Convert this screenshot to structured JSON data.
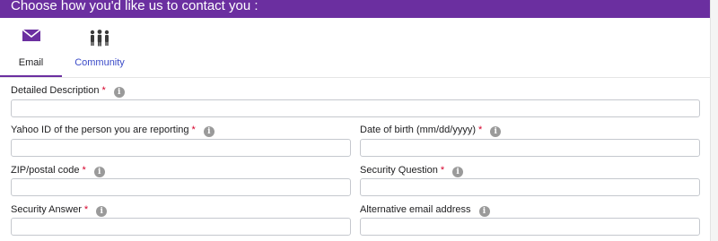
{
  "header": {
    "title": "Choose how you'd like us to contact you :"
  },
  "tabs": [
    {
      "label": "Email",
      "icon": "envelope-icon",
      "active": true
    },
    {
      "label": "Community",
      "icon": "people-icon",
      "active": false
    }
  ],
  "colors": {
    "brand": "#6b2fa0",
    "link": "#3b4bc8",
    "required": "#d6002a"
  },
  "form": {
    "required_mark": "*",
    "info_glyph": "i",
    "detailed_description": {
      "label": "Detailed Description",
      "value": ""
    },
    "yahoo_id": {
      "label": "Yahoo ID of the person you are reporting",
      "value": ""
    },
    "dob": {
      "label": "Date of birth (mm/dd/yyyy)",
      "value": ""
    },
    "zip": {
      "label": "ZIP/postal code",
      "value": ""
    },
    "security_question": {
      "label": "Security Question",
      "value": ""
    },
    "security_answer": {
      "label": "Security Answer",
      "value": ""
    },
    "alt_email": {
      "label": "Alternative email address",
      "value": ""
    }
  }
}
